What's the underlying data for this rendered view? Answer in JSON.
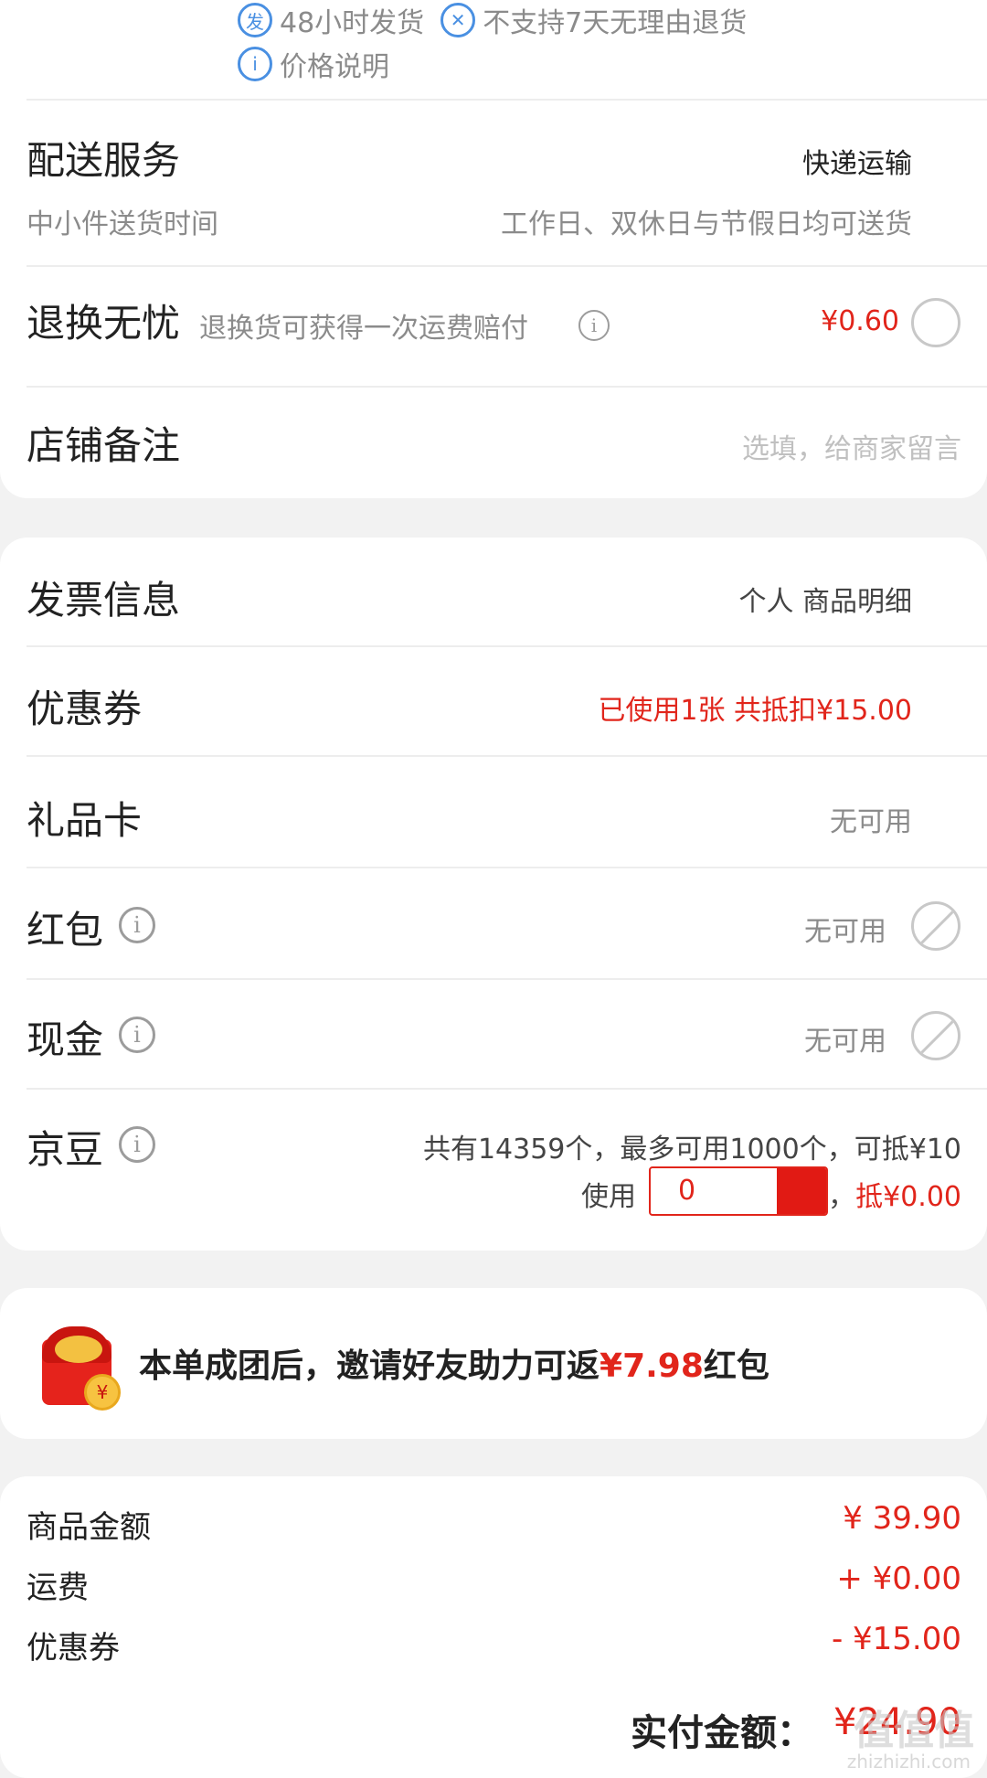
{
  "top_tags": {
    "ship_icon": "发",
    "ship_label": "48小时发货",
    "no_return_label": "不支持7天无理由退货",
    "price_note": "价格说明"
  },
  "delivery": {
    "title": "配送服务",
    "method": "快递运输",
    "time_label": "中小件送货时间",
    "time_value": "工作日、双休日与节假日均可送货"
  },
  "return_worry": {
    "title": "退换无忧",
    "desc": "退换货可获得一次运费赔付",
    "price": "¥0.60"
  },
  "shop_note": {
    "title": "店铺备注",
    "placeholder": "选填，给商家留言"
  },
  "invoice": {
    "title": "发票信息",
    "value": "个人 商品明细"
  },
  "coupon": {
    "title": "优惠券",
    "value": "已使用1张 共抵扣¥15.00"
  },
  "gift_card": {
    "title": "礼品卡",
    "value": "无可用"
  },
  "red_packet": {
    "title": "红包",
    "value": "无可用"
  },
  "cash": {
    "title": "现金",
    "value": "无可用"
  },
  "jd_beans": {
    "title": "京豆",
    "summary": "共有14359个，最多可用1000个，可抵¥10",
    "use_label": "使用",
    "input_value": "0",
    "comma": "，",
    "deduct": "抵¥0.00"
  },
  "promo": {
    "text_before": "本单成团后，邀请好友助力可返",
    "amount": "¥7.98",
    "text_after": "红包",
    "coin_symbol": "¥"
  },
  "summary": {
    "goods_label": "商品金额",
    "goods_value": "¥ 39.90",
    "shipping_label": "运费",
    "shipping_value": "+ ¥0.00",
    "coupon_label": "优惠券",
    "coupon_value": "- ¥15.00",
    "total_label": "实付金额：",
    "total_value": "¥24.90"
  },
  "watermark": {
    "main": "值值值",
    "sub": "zhizhizhi.com"
  },
  "colors": {
    "accent_red": "#e1251b",
    "link_blue": "#4a90e2",
    "gray_text": "#8b8b8b"
  }
}
